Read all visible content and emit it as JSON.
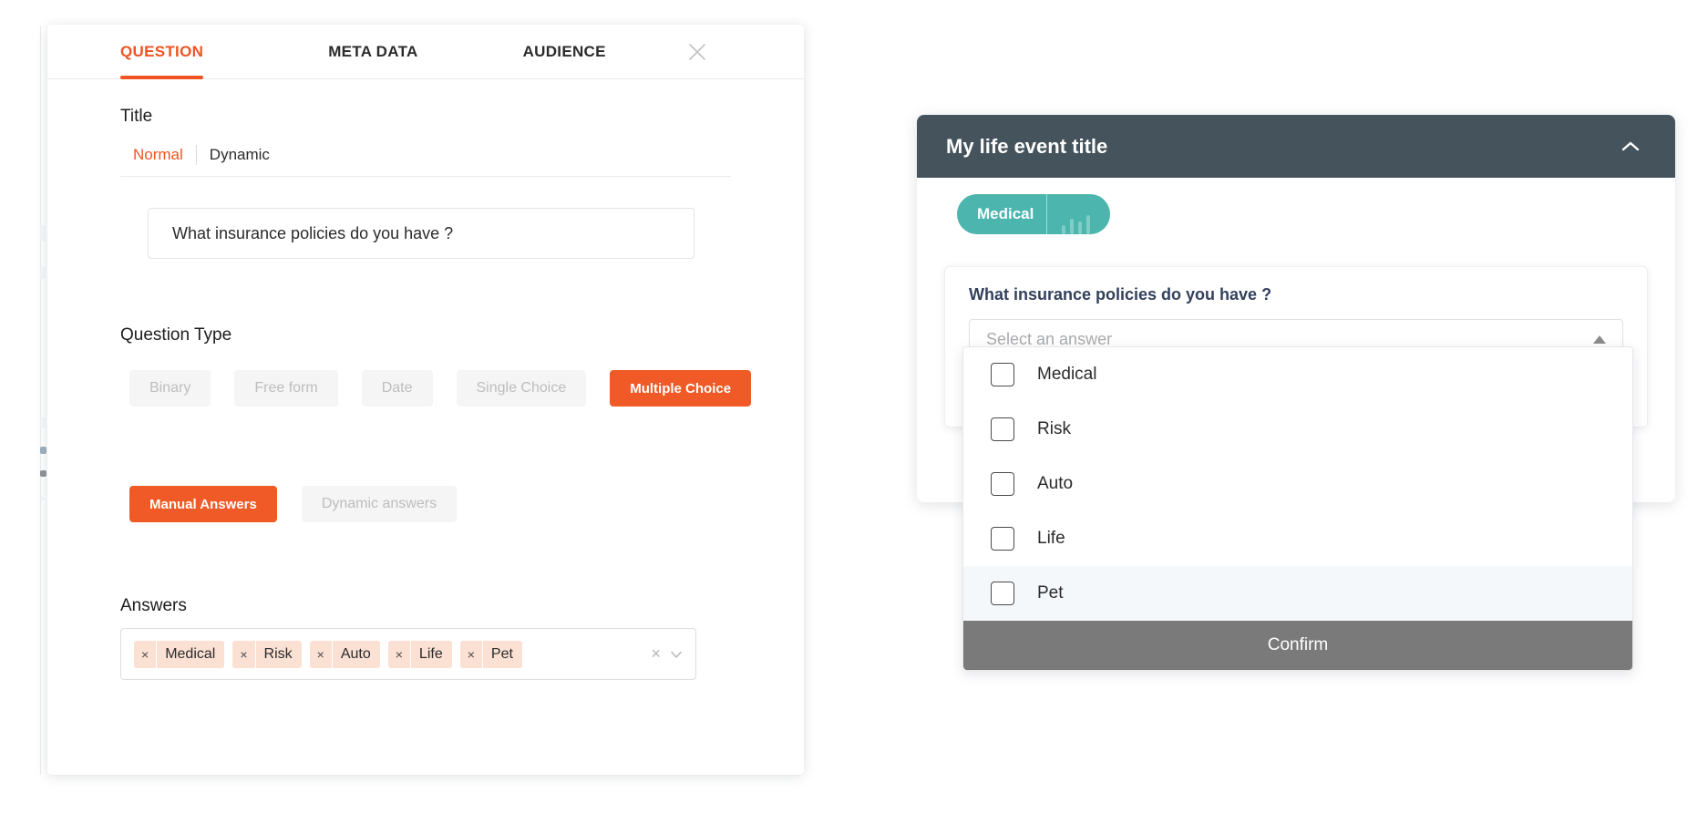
{
  "modal": {
    "tabs": [
      {
        "label": "QUESTION",
        "active": true
      },
      {
        "label": "META DATA",
        "active": false
      },
      {
        "label": "AUDIENCE",
        "active": false
      }
    ],
    "close_icon": "close-icon",
    "title_section": {
      "label": "Title",
      "subtabs": [
        {
          "label": "Normal",
          "active": true
        },
        {
          "label": "Dynamic",
          "active": false
        }
      ],
      "input_value": "What insurance policies do you have ?",
      "input_placeholder": "Title"
    },
    "question_type": {
      "label": "Question Type",
      "options": [
        {
          "label": "Binary",
          "selected": false
        },
        {
          "label": "Free form",
          "selected": false
        },
        {
          "label": "Date",
          "selected": false
        },
        {
          "label": "Single Choice",
          "selected": false
        },
        {
          "label": "Multiple Choice",
          "selected": true
        }
      ]
    },
    "answer_source": {
      "options": [
        {
          "label": "Manual Answers",
          "selected": true
        },
        {
          "label": "Dynamic answers",
          "selected": false
        }
      ]
    },
    "answers": {
      "label": "Answers",
      "tags": [
        "Medical",
        "Risk",
        "Auto",
        "Life",
        "Pet"
      ],
      "remove_glyph": "×",
      "clear_glyph": "×"
    }
  },
  "preview": {
    "header": {
      "title": "My life event title",
      "collapse_icon": "chevron-up-icon"
    },
    "chip": {
      "label": "Medical",
      "icon": "bar-chart-icon"
    },
    "question_card": {
      "question": "What insurance policies do you have ?",
      "select_placeholder": "Select an answer",
      "caret_icon": "caret-up-icon"
    },
    "dropdown": {
      "options": [
        {
          "label": "Medical",
          "checked": false,
          "highlighted": false
        },
        {
          "label": "Risk",
          "checked": false,
          "highlighted": false
        },
        {
          "label": "Auto",
          "checked": false,
          "highlighted": false
        },
        {
          "label": "Life",
          "checked": false,
          "highlighted": false
        },
        {
          "label": "Pet",
          "checked": false,
          "highlighted": true
        }
      ],
      "confirm_label": "Confirm"
    }
  },
  "colors": {
    "accent_orange": "#ef5a27",
    "header_slate": "#44535c",
    "chip_teal": "#4bb5ae",
    "tag_peach": "#fbe0d4",
    "button_grey": "#7a7a7a"
  }
}
